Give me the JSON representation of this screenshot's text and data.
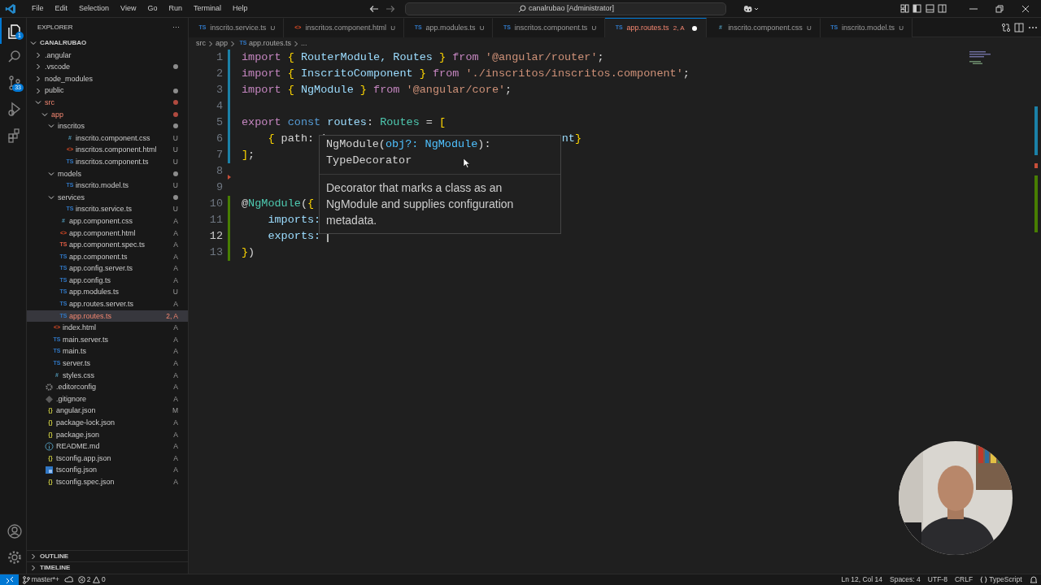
{
  "menu": [
    "File",
    "Edit",
    "Selection",
    "View",
    "Go",
    "Run",
    "Terminal",
    "Help"
  ],
  "command_center": "canalrubao [Administrator]",
  "activity_bar": {
    "items": [
      {
        "kind": "explorer",
        "selected": true,
        "badge": "1"
      },
      {
        "kind": "search",
        "selected": false
      },
      {
        "kind": "source-control",
        "selected": false,
        "badge": "33"
      },
      {
        "kind": "run",
        "selected": false
      },
      {
        "kind": "extensions",
        "selected": false
      }
    ],
    "bottom": [
      {
        "kind": "account"
      },
      {
        "kind": "settings"
      }
    ]
  },
  "sidebar": {
    "title": "EXPLORER",
    "more": "···",
    "root": "CANALRUBAO",
    "tree": [
      {
        "name": ".angular",
        "kind": "folder",
        "expanded": false
      },
      {
        "name": ".vscode",
        "kind": "folder",
        "expanded": false,
        "color": "#8c8c8c"
      },
      {
        "name": "node_modules",
        "kind": "folder",
        "expanded": false
      },
      {
        "name": "public",
        "kind": "folder",
        "expanded": false,
        "color": "#8c8c8c"
      },
      {
        "name": "src",
        "kind": "folder",
        "expanded": true,
        "error": true,
        "color": "#b04a3f",
        "children": [
          {
            "name": "app",
            "kind": "folder",
            "expanded": true,
            "error": true,
            "color": "#b04a3f",
            "children": [
              {
                "name": "inscritos",
                "kind": "folder",
                "expanded": true,
                "color": "#8c8c8c",
                "children": [
                  {
                    "name": "inscrito.component.css",
                    "kind": "css",
                    "icon": "#",
                    "status": "U",
                    "selected": false
                  },
                  {
                    "name": "inscritos.component.html",
                    "kind": "html",
                    "icon": "<>",
                    "status": "U",
                    "selected": false
                  },
                  {
                    "name": "inscritos.component.ts",
                    "kind": "ts",
                    "icon": "TS",
                    "status": "U",
                    "selected": false
                  }
                ]
              },
              {
                "name": "models",
                "kind": "folder",
                "expanded": true,
                "color": "#8c8c8c",
                "children": [
                  {
                    "name": "inscrito.model.ts",
                    "kind": "ts",
                    "icon": "TS",
                    "status": "U",
                    "selected": false
                  }
                ]
              },
              {
                "name": "services",
                "kind": "folder",
                "expanded": true,
                "color": "#8c8c8c",
                "children": [
                  {
                    "name": "inscrito.service.ts",
                    "kind": "ts",
                    "icon": "TS",
                    "status": "U",
                    "selected": false
                  }
                ]
              },
              {
                "name": "app.component.css",
                "kind": "css",
                "icon": "#",
                "status": "A",
                "selected": false
              },
              {
                "name": "app.component.html",
                "kind": "html",
                "icon": "<>",
                "status": "A",
                "selected": false
              },
              {
                "name": "app.component.spec.ts",
                "kind": "spec",
                "icon": "TS",
                "status": "A",
                "selected": false
              },
              {
                "name": "app.component.ts",
                "kind": "ts",
                "icon": "TS",
                "status": "A",
                "selected": false
              },
              {
                "name": "app.config.server.ts",
                "kind": "ts",
                "icon": "TS",
                "status": "A",
                "selected": false
              },
              {
                "name": "app.config.ts",
                "kind": "ts",
                "icon": "TS",
                "status": "A",
                "selected": false
              },
              {
                "name": "app.modules.ts",
                "kind": "ts",
                "icon": "TS",
                "status": "U",
                "selected": false
              },
              {
                "name": "app.routes.server.ts",
                "kind": "ts",
                "icon": "TS",
                "status": "A",
                "selected": false
              },
              {
                "name": "app.routes.ts",
                "kind": "ts",
                "icon": "TS",
                "status": "2, A",
                "selected": true,
                "error": true
              }
            ]
          },
          {
            "name": "index.html",
            "kind": "html",
            "icon": "<>",
            "status": "A",
            "selected": false
          },
          {
            "name": "main.server.ts",
            "kind": "ts",
            "icon": "TS",
            "status": "A",
            "selected": false
          },
          {
            "name": "main.ts",
            "kind": "ts",
            "icon": "TS",
            "status": "A",
            "selected": false
          },
          {
            "name": "server.ts",
            "kind": "ts",
            "icon": "TS",
            "status": "A",
            "selected": false
          },
          {
            "name": "styles.css",
            "kind": "css",
            "icon": "#",
            "status": "A",
            "selected": false
          }
        ]
      },
      {
        "name": ".editorconfig",
        "kind": "config",
        "status": "A",
        "selected": false
      },
      {
        "name": ".gitignore",
        "kind": "git",
        "status": "A",
        "selected": false
      },
      {
        "name": "angular.json",
        "kind": "json",
        "icon": "{}",
        "status": "M",
        "selected": false
      },
      {
        "name": "package-lock.json",
        "kind": "json",
        "icon": "{}",
        "status": "A",
        "selected": false
      },
      {
        "name": "package.json",
        "kind": "json",
        "icon": "{}",
        "status": "A",
        "selected": false
      },
      {
        "name": "README.md",
        "kind": "md",
        "status": "A",
        "selected": false
      },
      {
        "name": "tsconfig.app.json",
        "kind": "json",
        "icon": "{}",
        "status": "A",
        "selected": false
      },
      {
        "name": "tsconfig.json",
        "kind": "tsconfig",
        "status": "A",
        "selected": false
      },
      {
        "name": "tsconfig.spec.json",
        "kind": "json",
        "icon": "{}",
        "status": "A",
        "selected": false
      }
    ],
    "sections": [
      {
        "title": "OUTLINE",
        "expanded": false
      },
      {
        "title": "TIMELINE",
        "expanded": false
      }
    ]
  },
  "tabs": [
    {
      "label": "inscrito.service.ts",
      "kind": "ts",
      "icon": "TS",
      "status": "U",
      "selected": false,
      "modified": false
    },
    {
      "label": "inscritos.component.html",
      "kind": "html",
      "icon": "<>",
      "status": "U",
      "selected": false,
      "modified": false
    },
    {
      "label": "app.modules.ts",
      "kind": "ts",
      "icon": "TS",
      "status": "U",
      "selected": false,
      "modified": false
    },
    {
      "label": "inscritos.component.ts",
      "kind": "ts",
      "icon": "TS",
      "status": "U",
      "selected": false,
      "modified": false
    },
    {
      "label": "app.routes.ts",
      "kind": "ts",
      "icon": "TS",
      "status": "2, A",
      "selected": true,
      "modified": true,
      "error": true
    },
    {
      "label": "inscrito.component.css",
      "kind": "css",
      "icon": "#",
      "status": "U",
      "selected": false,
      "modified": false
    },
    {
      "label": "inscrito.model.ts",
      "kind": "ts",
      "icon": "TS",
      "status": "U",
      "selected": false,
      "modified": false
    }
  ],
  "breadcrumb": [
    {
      "text": "src"
    },
    {
      "text": "app"
    },
    {
      "text": "app.routes.ts",
      "icon": "TS"
    },
    {
      "text": "..."
    }
  ],
  "code": [
    {
      "number": "1",
      "modified": true,
      "added": false,
      "deleted": false,
      "tokens": [
        {
          "text": "import ",
          "kind": "kw"
        },
        {
          "text": "{ ",
          "kind": "brace"
        },
        {
          "text": "RouterModule, Routes ",
          "kind": "var"
        },
        {
          "text": "} ",
          "kind": "brace"
        },
        {
          "text": "from ",
          "kind": "kw"
        },
        {
          "text": "'@angular/router'",
          "kind": "str"
        },
        {
          "text": ";",
          "kind": "plain"
        }
      ]
    },
    {
      "number": "2",
      "modified": true,
      "added": false,
      "deleted": false,
      "tokens": [
        {
          "text": "import ",
          "kind": "kw"
        },
        {
          "text": "{ ",
          "kind": "brace"
        },
        {
          "text": "InscritoComponent ",
          "kind": "var"
        },
        {
          "text": "} ",
          "kind": "brace"
        },
        {
          "text": "from ",
          "kind": "kw"
        },
        {
          "text": "'./inscritos/inscritos.component'",
          "kind": "str"
        },
        {
          "text": ";",
          "kind": "plain"
        }
      ]
    },
    {
      "number": "3",
      "modified": true,
      "added": false,
      "deleted": false,
      "tokens": [
        {
          "text": "import ",
          "kind": "kw"
        },
        {
          "text": "{ ",
          "kind": "brace"
        },
        {
          "text": "NgModule ",
          "kind": "var"
        },
        {
          "text": "} ",
          "kind": "brace"
        },
        {
          "text": "from ",
          "kind": "kw"
        },
        {
          "text": "'@angular/core'",
          "kind": "str"
        },
        {
          "text": ";",
          "kind": "plain"
        }
      ]
    },
    {
      "number": "4",
      "modified": true,
      "added": false,
      "deleted": false
    },
    {
      "number": "5",
      "modified": true,
      "added": false,
      "deleted": false,
      "tokens": [
        {
          "text": "export ",
          "kind": "kw"
        },
        {
          "text": "const ",
          "kind": "storage"
        },
        {
          "text": "routes",
          "kind": "var"
        },
        {
          "text": ": ",
          "kind": "plain"
        },
        {
          "text": "Routes ",
          "kind": "type"
        },
        {
          "text": "= ",
          "kind": "plain"
        },
        {
          "text": "[",
          "kind": "brace"
        }
      ]
    },
    {
      "number": "6",
      "modified": true,
      "added": false,
      "deleted": false,
      "indented": true,
      "tokens": [
        {
          "text": "{ ",
          "kind": "brace"
        },
        {
          "text": "path: '",
          "kind": "plain"
        }
      ],
      "tail": [
        {
          "text": "nt",
          "kind": "var"
        },
        {
          "text": "}",
          "kind": "brace"
        }
      ]
    },
    {
      "number": "7",
      "modified": true,
      "added": false,
      "deleted": false,
      "tokens": [
        {
          "text": "]",
          "kind": "brace"
        },
        {
          "text": ";",
          "kind": "plain"
        }
      ]
    },
    {
      "number": "8",
      "modified": false,
      "added": false,
      "deleted": true
    },
    {
      "number": "9",
      "modified": false,
      "added": false,
      "deleted": false
    },
    {
      "number": "10",
      "modified": false,
      "added": true,
      "deleted": false,
      "tokens": [
        {
          "text": "@",
          "kind": "plain"
        },
        {
          "text": "NgModule",
          "kind": "type"
        },
        {
          "text": "(",
          "kind": "plain"
        },
        {
          "text": "{",
          "kind": "brace"
        }
      ]
    },
    {
      "number": "11",
      "modified": false,
      "added": true,
      "deleted": false,
      "indented": true,
      "tokens": [
        {
          "text": "imports: ",
          "kind": "var"
        }
      ]
    },
    {
      "number": "12",
      "modified": false,
      "added": true,
      "deleted": false,
      "indented": true,
      "current": true,
      "cursor": true,
      "tokens": [
        {
          "text": "exports: ",
          "kind": "var"
        }
      ]
    },
    {
      "number": "13",
      "modified": false,
      "added": true,
      "deleted": false,
      "tokens": [
        {
          "text": "}",
          "kind": "brace"
        },
        {
          "text": ")",
          "kind": "plain"
        }
      ]
    }
  ],
  "hover": {
    "signature": [
      {
        "text": "NgModule(",
        "kind": "plain"
      },
      {
        "text": "obj?: NgModule",
        "kind": "param"
      },
      {
        "text": "):",
        "kind": "plain"
      }
    ],
    "return_type": "TypeDecorator",
    "doc": "Decorator that marks a class as an NgModule and supplies configuration metadata."
  },
  "status_bar": {
    "branch": "master*+",
    "errors": "2",
    "warnings": "0",
    "position": "Ln 12, Col 14",
    "indentation": "Spaces: 4",
    "encoding": "UTF-8",
    "eol": "CRLF",
    "language": "TypeScript"
  }
}
